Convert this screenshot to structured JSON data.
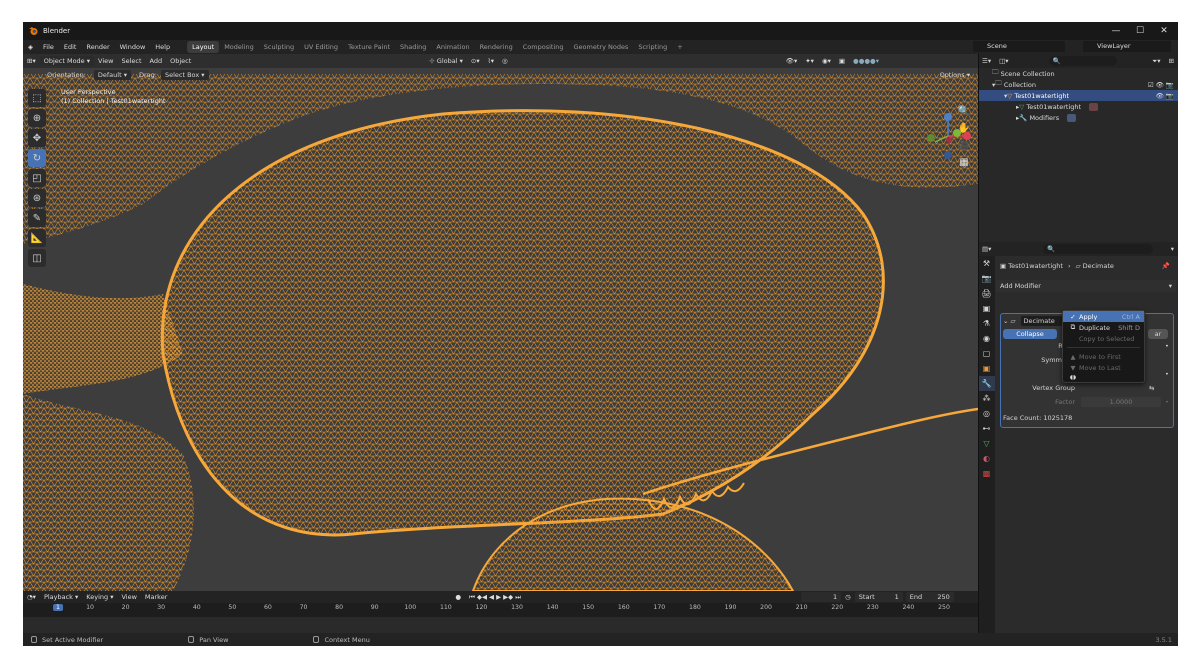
{
  "app": {
    "title": "Blender",
    "version": "3.5.1"
  },
  "menus": [
    "File",
    "Edit",
    "Render",
    "Window",
    "Help"
  ],
  "workspaces": [
    "Layout",
    "Modeling",
    "Sculpting",
    "UV Editing",
    "Texture Paint",
    "Shading",
    "Animation",
    "Rendering",
    "Compositing",
    "Geometry Nodes",
    "Scripting"
  ],
  "active_workspace": "Layout",
  "scene": "Scene",
  "view_layer": "ViewLayer",
  "viewport": {
    "mode": "Object Mode",
    "menus": [
      "View",
      "Select",
      "Add",
      "Object"
    ],
    "transform": "Global",
    "orientation_label": "Orientation:",
    "orientation_value": "Default",
    "drag_label": "Drag:",
    "drag_value": "Select Box",
    "options": "Options",
    "overlay_line1": "User Perspective",
    "overlay_line2": "(1) Collection | Test01watertight",
    "mesh_color": "#f09a2c",
    "background": "#3d3d3d"
  },
  "outliner": {
    "rows": [
      "Scene Collection",
      "Collection",
      "Test01watertight",
      "Test01watertight",
      "Modifiers"
    ]
  },
  "properties": {
    "breadcrumb_object": "Test01watertight",
    "breadcrumb_modifier": "Decimate",
    "add_modifier": "Add Modifier",
    "modifier_name": "Decimate",
    "collapse": "Collapse",
    "ratio": "Ratio",
    "symmetry": "Symmetry",
    "vertex_group": "Vertex Group",
    "factor_label": "Factor",
    "factor_value": "1.0000",
    "face_count": "Face Count: 1025178",
    "hidden_tab_tail": "ar"
  },
  "context_menu": {
    "apply": "Apply",
    "apply_key": "Ctrl A",
    "duplicate": "Duplicate",
    "duplicate_key": "Shift D",
    "copy_to_selected": "Copy to Selected",
    "move_first": "Move to First",
    "move_last": "Move to Last"
  },
  "timeline": {
    "menus": [
      "Playback",
      "Keying",
      "View",
      "Marker"
    ],
    "current_frame": "1",
    "start_label": "Start",
    "start": "1",
    "end_label": "End",
    "end": "250",
    "ticks": [
      "1",
      "10",
      "20",
      "30",
      "40",
      "50",
      "60",
      "70",
      "80",
      "90",
      "100",
      "110",
      "120",
      "130",
      "140",
      "150",
      "160",
      "170",
      "180",
      "190",
      "200",
      "210",
      "220",
      "230",
      "240",
      "250"
    ]
  },
  "status": {
    "left": "Set Active Modifier",
    "middle": "Pan View",
    "right": "Context Menu"
  }
}
